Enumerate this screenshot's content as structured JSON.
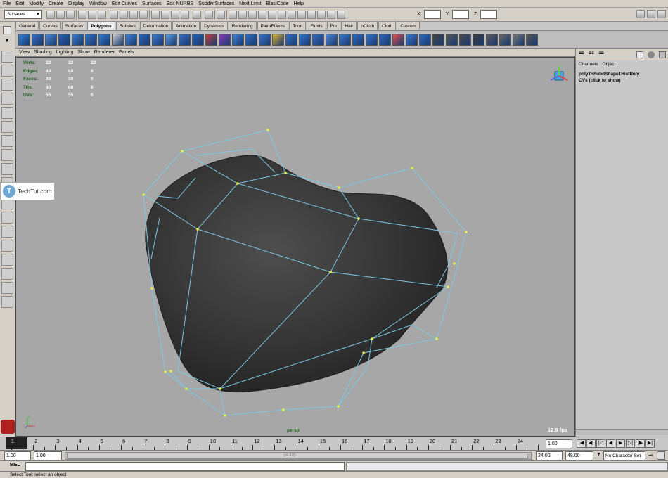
{
  "menu": [
    "File",
    "Edit",
    "Modify",
    "Create",
    "Display",
    "Window",
    "Edit Curves",
    "Surfaces",
    "Edit NURBS",
    "Subdiv Surfaces",
    "Next Limit",
    "BlastCode",
    "Help"
  ],
  "status_line": {
    "menu_set": "Surfaces",
    "x_label": "X:",
    "y_label": "Y:",
    "z_label": "Z:"
  },
  "shelf_tabs": [
    {
      "label": "General",
      "active": false
    },
    {
      "label": "Curves",
      "active": false
    },
    {
      "label": "Surfaces",
      "active": false
    },
    {
      "label": "Polygons",
      "active": true
    },
    {
      "label": "Subdivs",
      "active": false
    },
    {
      "label": "Deformation",
      "active": false
    },
    {
      "label": "Animation",
      "active": false
    },
    {
      "label": "Dynamics",
      "active": false
    },
    {
      "label": "Rendering",
      "active": false
    },
    {
      "label": "PaintEffects",
      "active": false
    },
    {
      "label": "Toon",
      "active": false
    },
    {
      "label": "Fluids",
      "active": false
    },
    {
      "label": "Fur",
      "active": false
    },
    {
      "label": "Hair",
      "active": false
    },
    {
      "label": "nCloth",
      "active": false
    },
    {
      "label": "Cloth",
      "active": false
    },
    {
      "label": "Custom",
      "active": false
    }
  ],
  "panel_menu": [
    "View",
    "Shading",
    "Lighting",
    "Show",
    "Renderer",
    "Panels"
  ],
  "hud": [
    {
      "label": "Verts:",
      "values": [
        "32",
        "32",
        "32"
      ]
    },
    {
      "label": "Edges:",
      "values": [
        "60",
        "60",
        "0"
      ]
    },
    {
      "label": "Faces:",
      "values": [
        "30",
        "30",
        "0"
      ]
    },
    {
      "label": "Tris:",
      "values": [
        "60",
        "60",
        "0"
      ]
    },
    {
      "label": "UVs:",
      "values": [
        "55",
        "55",
        "0"
      ]
    }
  ],
  "viewport": {
    "camera": "persp",
    "fps": "12.8 fps",
    "mesh_color": "#3a3a3a",
    "cage_color": "#7ec8e3",
    "vertex_color": "#e8f040"
  },
  "channel_box": {
    "tabs": [
      "Channels",
      "Object"
    ],
    "node": "polyToSubdShape1HistPoly",
    "cvs": "CVs (click to show)"
  },
  "watermark": {
    "text": "TechTut.com",
    "logo": "T"
  },
  "timeline": {
    "ticks": [
      "1",
      "2",
      "3",
      "4",
      "5",
      "6",
      "7",
      "8",
      "9",
      "10",
      "11",
      "12",
      "13",
      "14",
      "15",
      "16",
      "17",
      "18",
      "19",
      "20",
      "21",
      "22",
      "23",
      "24"
    ],
    "current_frame": "1.00"
  },
  "range": {
    "start": "1.00",
    "playback_start": "1.00",
    "slider_value": "24.00",
    "playback_end": "24.00",
    "end": "48.00",
    "char_set": "No Character Set"
  },
  "command": {
    "label": "MEL"
  },
  "help_line": "Select Tool: select an object"
}
